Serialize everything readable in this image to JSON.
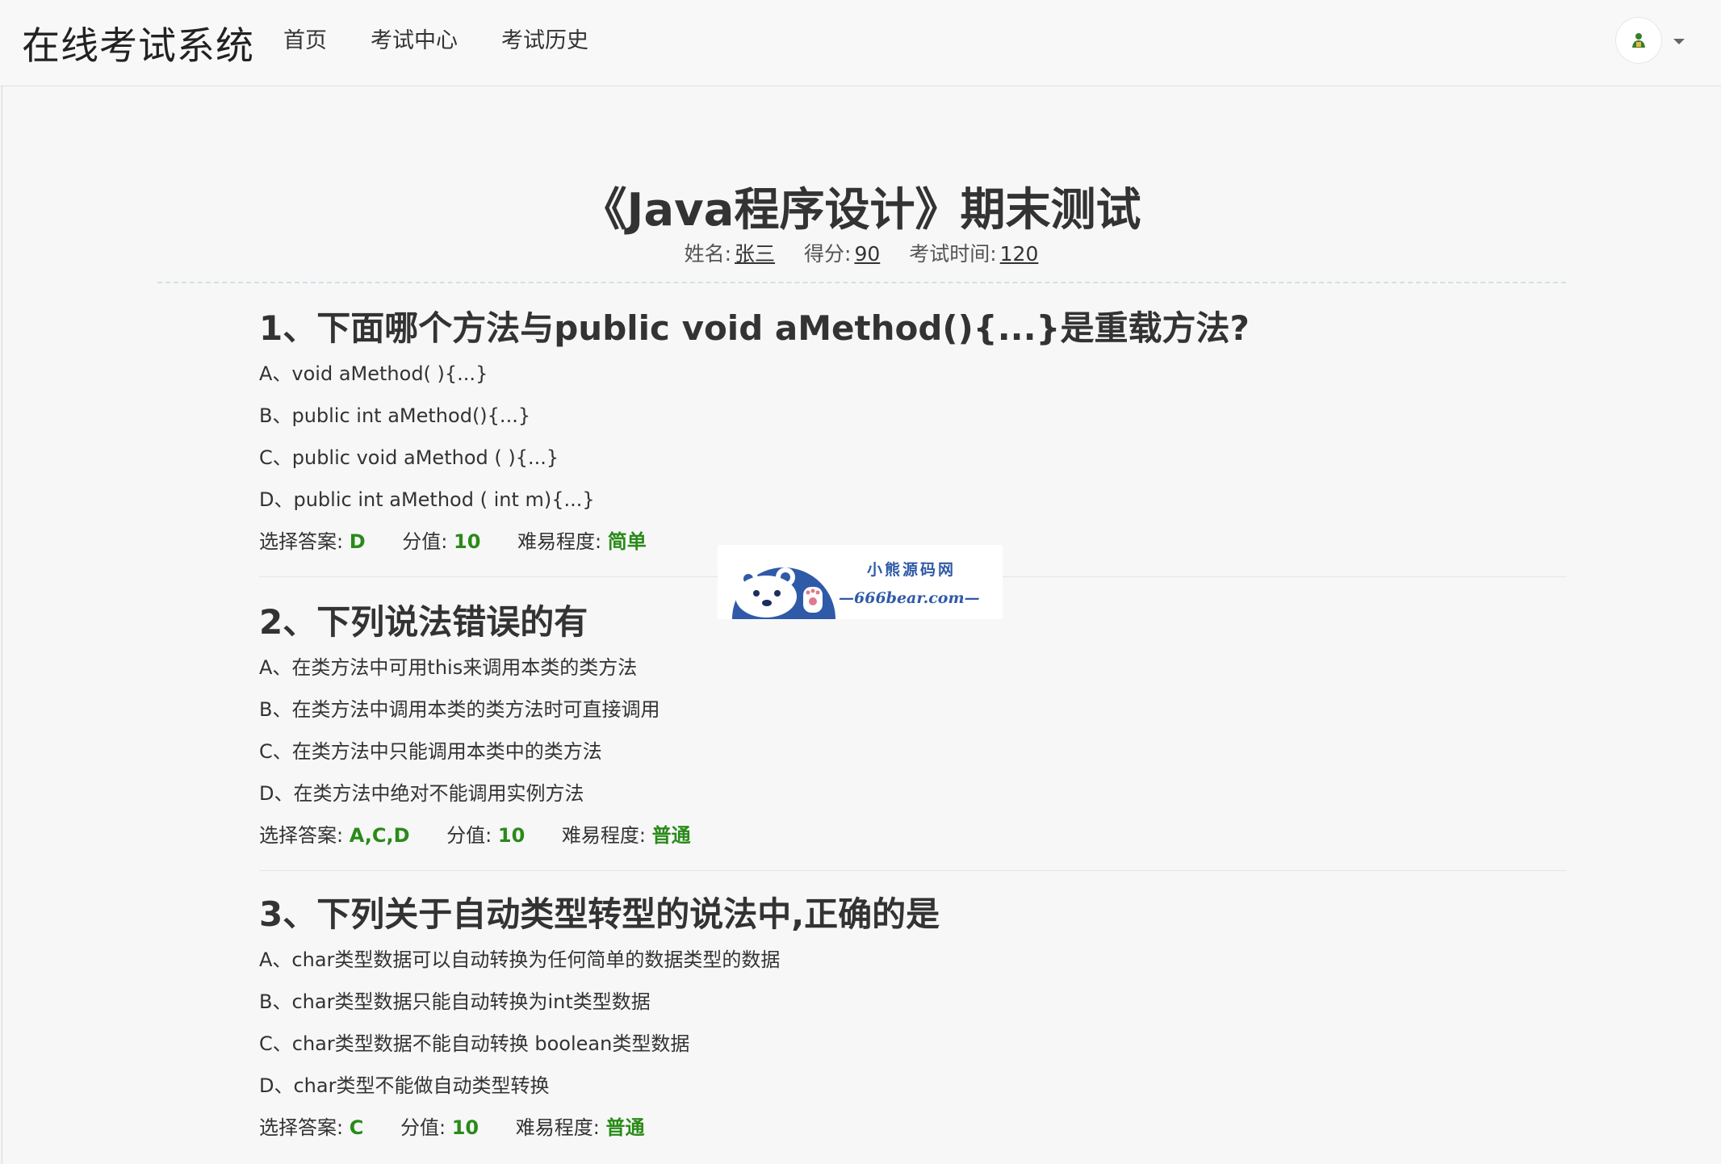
{
  "navbar": {
    "brand": "在线考试系统",
    "links": [
      "首页",
      "考试中心",
      "考试历史"
    ]
  },
  "exam": {
    "title": "《Java程序设计》期末测试",
    "name_label": "姓名:",
    "name_value": "张三",
    "score_label": "得分:",
    "score_value": "90",
    "time_label": "考试时间:",
    "time_value": "120"
  },
  "labels": {
    "answer": "选择答案: ",
    "points": "分值: ",
    "difficulty": "难易程度: "
  },
  "questions": [
    {
      "title": "1、下面哪个方法与public void aMethod(){...}是重载方法?",
      "options": [
        "A、void aMethod( ){...}",
        "B、public int aMethod(){...}",
        "C、public void aMethod ( ){...}",
        "D、public int aMethod ( int m){...}"
      ],
      "answer": "D",
      "points": "10",
      "difficulty": "简单"
    },
    {
      "title": "2、下列说法错误的有",
      "options": [
        "A、在类方法中可用this来调用本类的类方法",
        "B、在类方法中调用本类的类方法时可直接调用",
        "C、在类方法中只能调用本类中的类方法",
        "D、在类方法中绝对不能调用实例方法"
      ],
      "answer": "A,C,D",
      "points": "10",
      "difficulty": "普通"
    },
    {
      "title": "3、下列关于自动类型转型的说法中,正确的是",
      "options": [
        "A、char类型数据可以自动转换为任何简单的数据类型的数据",
        "B、char类型数据只能自动转换为int类型数据",
        "C、char类型数据不能自动转换 boolean类型数据",
        "D、char类型不能做自动类型转换"
      ],
      "answer": "C",
      "points": "10",
      "difficulty": "普通"
    }
  ],
  "watermark": {
    "line1": "小熊源码网",
    "line2": "—666bear.com—"
  },
  "colors": {
    "accent_green": "#2a8a19",
    "watermark_blue": "#2f5aa8"
  },
  "icons": {
    "avatar": "user-avatar-icon",
    "dropdown": "caret-down-icon"
  }
}
